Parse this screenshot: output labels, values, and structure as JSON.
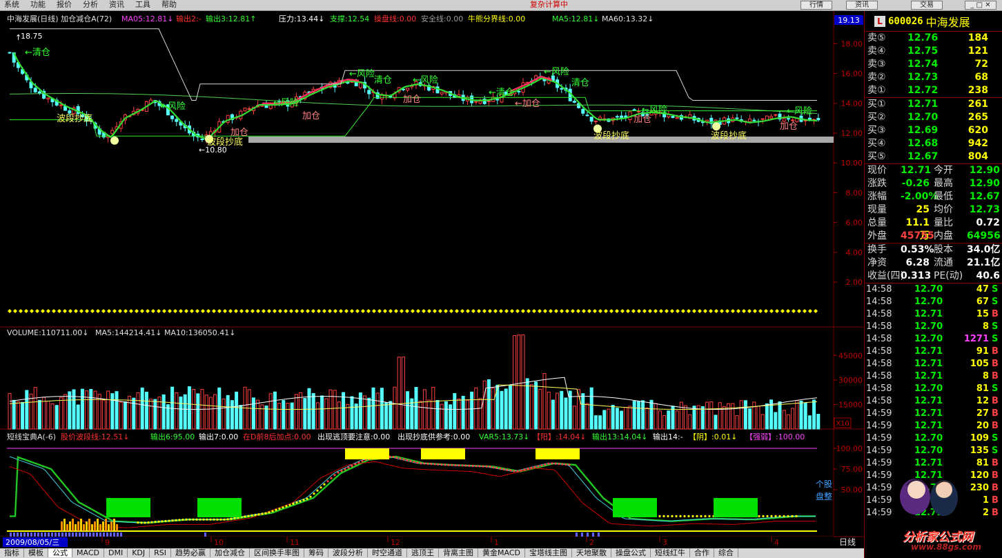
{
  "topbar": {
    "menu": [
      "系统",
      "功能",
      "报价",
      "分析",
      "资讯",
      "工具",
      "帮助"
    ],
    "center_title": "复杂计算中",
    "buttons": [
      "行情",
      "资讯",
      "交易"
    ]
  },
  "main_panel": {
    "indicator_items": [
      {
        "text": "中海发展(日线) 加仓减仓A(72)",
        "color": "#e0e0e0"
      },
      {
        "text": "MA05:12.81↓",
        "color": "#ff40ff"
      },
      {
        "text": "输出2:-",
        "color": "#ff3030"
      },
      {
        "text": "输出3:12.81↑",
        "color": "#30ff30"
      },
      {
        "text": "压力:13.44↓",
        "color": "#ffffff"
      },
      {
        "text": "支撑:12.54",
        "color": "#30ff30"
      },
      {
        "text": "操盘线:0.00",
        "color": "#ff3030"
      },
      {
        "text": "安全线:0.00",
        "color": "#9a9a9a"
      },
      {
        "text": "牛熊分界线:0.00",
        "color": "#ffff00"
      },
      {
        "text": "MA5:12.81↓",
        "color": "#30ff30"
      },
      {
        "text": "MA60:13.32↓",
        "color": "#e0e0e0"
      }
    ],
    "y_axis": [
      "18.00",
      "16.00",
      "14.00",
      "12.00",
      "10.00",
      "8.00",
      "6.00",
      "4.00",
      "2.00"
    ],
    "last_price_tag": "19.13",
    "high_label": "18.75",
    "low_label": "←10.80",
    "annotations": [
      {
        "text": "←清仓",
        "color": "#30ff30"
      },
      {
        "text": "波段抄底",
        "color": "#ffff60"
      },
      {
        "text": "←风险",
        "color": "#30ff30"
      },
      {
        "text": "波段抄底",
        "color": "#ffff60"
      },
      {
        "text": "加仓",
        "color": "#ff8080"
      },
      {
        "text": "←风险",
        "color": "#30ff30"
      },
      {
        "text": "加仓",
        "color": "#ff8080"
      },
      {
        "text": "←风险",
        "color": "#30ff30"
      },
      {
        "text": "清仓",
        "color": "#30ff30"
      },
      {
        "text": "←风险",
        "color": "#30ff30"
      },
      {
        "text": "加仓",
        "color": "#ff8080"
      },
      {
        "text": "←清仓",
        "color": "#30ff30"
      },
      {
        "text": "←加仓",
        "color": "#ff8080"
      },
      {
        "text": "←风险",
        "color": "#30ff30"
      },
      {
        "text": "清仓",
        "color": "#30ff30"
      },
      {
        "text": "←风险",
        "color": "#30ff30"
      },
      {
        "text": "波段抄底",
        "color": "#ffff60"
      },
      {
        "text": "加仓",
        "color": "#ff8080"
      },
      {
        "text": "波段抄底",
        "color": "#ffff60"
      },
      {
        "text": "←风险",
        "color": "#30ff30"
      },
      {
        "text": "加仓",
        "color": "#ff8080"
      }
    ]
  },
  "volume_panel": {
    "indicator_items": [
      {
        "text": "VOLUME:110711.00↓",
        "color": "#e0e0e0"
      },
      {
        "text": "MA5:144214.41↓",
        "color": "#e0e0e0"
      },
      {
        "text": "MA10:136050.41↓",
        "color": "#e0e0e0"
      }
    ],
    "y_axis": [
      "45000",
      "30000",
      "15000"
    ],
    "unit": "X10"
  },
  "lower_panel": {
    "indicator_items": [
      {
        "text": "短线宝典A(-6)",
        "color": "#e0e0e0"
      },
      {
        "text": "股价波段线:12.51↓",
        "color": "#ff3030"
      },
      {
        "text": "输出6:95.00",
        "color": "#30ff30"
      },
      {
        "text": "输出7:0.00",
        "color": "#ffffff"
      },
      {
        "text": "在D前8后加点:0.00",
        "color": "#ff3030"
      },
      {
        "text": "出现逃顶要注意:0.00",
        "color": "#ffffff"
      },
      {
        "text": "出现抄底供参考:0.00",
        "color": "#ffffff"
      },
      {
        "text": "VAR5:13.73↓",
        "color": "#30ff30"
      },
      {
        "text": "【阳】:14.04↓",
        "color": "#ff3030"
      },
      {
        "text": "输出13:14.04↓",
        "color": "#30ff30"
      },
      {
        "text": "输出14:-",
        "color": "#ffffff"
      },
      {
        "text": "【阴】:0.01↓",
        "color": "#ffff00"
      },
      {
        "text": "【强弱】:100.00",
        "color": "#ff40ff"
      }
    ],
    "y_axis": [
      "100.00",
      "75.00",
      "50.00"
    ],
    "side_labels": [
      "个股",
      "盘整"
    ]
  },
  "x_axis": {
    "start_date": "2009/08/05/三",
    "months": [
      "9",
      "10",
      "11",
      "12",
      "1",
      "2",
      "3",
      "4"
    ],
    "period": "日线"
  },
  "bottom_tabs": [
    "指标",
    "模板",
    "公式",
    "MACD",
    "DMI",
    "KDJ",
    "RSI",
    "趋势必赢",
    "加仓减仓",
    "区间换手率图",
    "筹码",
    "波段分析",
    "时空通道",
    "逃顶王",
    "背离主图",
    "黄金MACD",
    "宝塔线主图",
    "天地聚散",
    "操盘公式",
    "短线红牛",
    "合作",
    "综合"
  ],
  "quote": {
    "badge": "L",
    "code": "600026",
    "name": "中海发展",
    "asks": [
      {
        "label": "卖⑤",
        "price": "12.76",
        "vol": "184"
      },
      {
        "label": "卖④",
        "price": "12.75",
        "vol": "121"
      },
      {
        "label": "卖③",
        "price": "12.74",
        "vol": "72"
      },
      {
        "label": "卖②",
        "price": "12.73",
        "vol": "68"
      },
      {
        "label": "卖①",
        "price": "12.72",
        "vol": "238"
      }
    ],
    "bids": [
      {
        "label": "买①",
        "price": "12.71",
        "vol": "261"
      },
      {
        "label": "买②",
        "price": "12.70",
        "vol": "265"
      },
      {
        "label": "买③",
        "price": "12.69",
        "vol": "620"
      },
      {
        "label": "买④",
        "price": "12.68",
        "vol": "942"
      },
      {
        "label": "买⑤",
        "price": "12.67",
        "vol": "804"
      }
    ],
    "stats": [
      {
        "l1": "现价",
        "v1": "12.71",
        "c1": "#00ee00",
        "l2": "今开",
        "v2": "12.90",
        "c2": "#00ee00"
      },
      {
        "l1": "涨跌",
        "v1": "-0.26",
        "c1": "#00ee00",
        "l2": "最高",
        "v2": "12.90",
        "c2": "#00ee00"
      },
      {
        "l1": "涨幅",
        "v1": "-2.00%",
        "c1": "#00ee00",
        "l2": "最低",
        "v2": "12.67",
        "c2": "#00ee00"
      },
      {
        "l1": "现量",
        "v1": "25",
        "c1": "#ffff00",
        "l2": "均价",
        "v2": "12.73",
        "c2": "#00ee00"
      },
      {
        "l1": "总量",
        "v1": "11.1万",
        "c1": "#ffff00",
        "l2": "量比",
        "v2": "0.72",
        "c2": "#ffffff"
      },
      {
        "l1": "外盘",
        "v1": "45755",
        "c1": "#ff4040",
        "l2": "内盘",
        "v2": "64956",
        "c2": "#00ee00"
      }
    ],
    "stats2": [
      {
        "l1": "换手",
        "v1": "0.53%",
        "c1": "#ffffff",
        "l2": "股本",
        "v2": "34.0亿",
        "c2": "#ffffff"
      },
      {
        "l1": "净资",
        "v1": "6.28",
        "c1": "#ffffff",
        "l2": "流通",
        "v2": "21.1亿",
        "c2": "#ffffff"
      },
      {
        "l1": "收益(四)",
        "v1": "0.313",
        "c1": "#ffffff",
        "l2": "PE(动)",
        "v2": "40.6",
        "c2": "#ffffff"
      }
    ],
    "ticks": [
      {
        "time": "14:58",
        "price": "12.70",
        "vol": "47",
        "side": "S"
      },
      {
        "time": "14:58",
        "price": "12.70",
        "vol": "67",
        "side": "S"
      },
      {
        "time": "14:58",
        "price": "12.71",
        "vol": "15",
        "side": "B"
      },
      {
        "time": "14:58",
        "price": "12.70",
        "vol": "8",
        "side": "S"
      },
      {
        "time": "14:58",
        "price": "12.70",
        "vol": "1271",
        "side": "S"
      },
      {
        "time": "14:58",
        "price": "12.71",
        "vol": "91",
        "side": "B"
      },
      {
        "time": "14:58",
        "price": "12.71",
        "vol": "105",
        "side": "B"
      },
      {
        "time": "14:58",
        "price": "12.71",
        "vol": "8",
        "side": "B"
      },
      {
        "time": "14:58",
        "price": "12.70",
        "vol": "81",
        "side": "S"
      },
      {
        "time": "14:58",
        "price": "12.71",
        "vol": "12",
        "side": "B"
      },
      {
        "time": "14:59",
        "price": "12.71",
        "vol": "27",
        "side": "B"
      },
      {
        "time": "14:59",
        "price": "12.71",
        "vol": "20",
        "side": "B"
      },
      {
        "time": "14:59",
        "price": "12.70",
        "vol": "109",
        "side": "S"
      },
      {
        "time": "14:59",
        "price": "12.70",
        "vol": "135",
        "side": "S"
      },
      {
        "time": "14:59",
        "price": "12.71",
        "vol": "81",
        "side": "B"
      },
      {
        "time": "14:59",
        "price": "12.71",
        "vol": "120",
        "side": "B"
      },
      {
        "time": "14:59",
        "price": "12.71",
        "vol": "230",
        "side": "B"
      },
      {
        "time": "14:59",
        "price": "12.71",
        "vol": "1",
        "side": "B"
      },
      {
        "time": "14:59",
        "price": "12.71",
        "vol": "2",
        "side": "B"
      }
    ]
  },
  "watermark": {
    "text": "分析家公式网",
    "url": "www.88gs.com"
  },
  "chart_data": {
    "type": "candlestick",
    "price_range": [
      0,
      19.13
    ],
    "price_path": [
      [
        0,
        17.2
      ],
      [
        6,
        18.2
      ],
      [
        20,
        16.8
      ],
      [
        40,
        15.4
      ],
      [
        60,
        14.6
      ],
      [
        90,
        13.8
      ],
      [
        120,
        13.2
      ],
      [
        140,
        12.2
      ],
      [
        155,
        11.7
      ],
      [
        175,
        13.0
      ],
      [
        200,
        13.6
      ],
      [
        220,
        14.2
      ],
      [
        240,
        13.6
      ],
      [
        260,
        12.6
      ],
      [
        280,
        11.8
      ],
      [
        295,
        11.6
      ],
      [
        320,
        12.8
      ],
      [
        345,
        13.2
      ],
      [
        370,
        13.9
      ],
      [
        395,
        13.9
      ],
      [
        420,
        14.0
      ],
      [
        445,
        14.6
      ],
      [
        470,
        15.1
      ],
      [
        500,
        15.5
      ],
      [
        520,
        15.4
      ],
      [
        540,
        14.6
      ],
      [
        560,
        14.5
      ],
      [
        580,
        15.1
      ],
      [
        600,
        15.3
      ],
      [
        620,
        15.1
      ],
      [
        640,
        14.8
      ],
      [
        660,
        14.4
      ],
      [
        680,
        14.2
      ],
      [
        700,
        14.2
      ],
      [
        720,
        14.4
      ],
      [
        740,
        14.8
      ],
      [
        760,
        15.2
      ],
      [
        780,
        15.7
      ],
      [
        800,
        15.4
      ],
      [
        820,
        14.7
      ],
      [
        840,
        13.7
      ],
      [
        860,
        12.9
      ],
      [
        880,
        12.9
      ],
      [
        900,
        13.0
      ],
      [
        920,
        13.3
      ],
      [
        940,
        13.4
      ],
      [
        960,
        13.3
      ],
      [
        980,
        13.1
      ],
      [
        1000,
        13.0
      ],
      [
        1020,
        12.7
      ],
      [
        1040,
        12.8
      ],
      [
        1060,
        12.9
      ],
      [
        1080,
        12.7
      ],
      [
        1100,
        12.8
      ],
      [
        1120,
        13.0
      ],
      [
        1140,
        13.1
      ],
      [
        1160,
        12.9
      ],
      [
        1185,
        12.8
      ]
    ],
    "volume_range": [
      0,
      54000
    ]
  }
}
